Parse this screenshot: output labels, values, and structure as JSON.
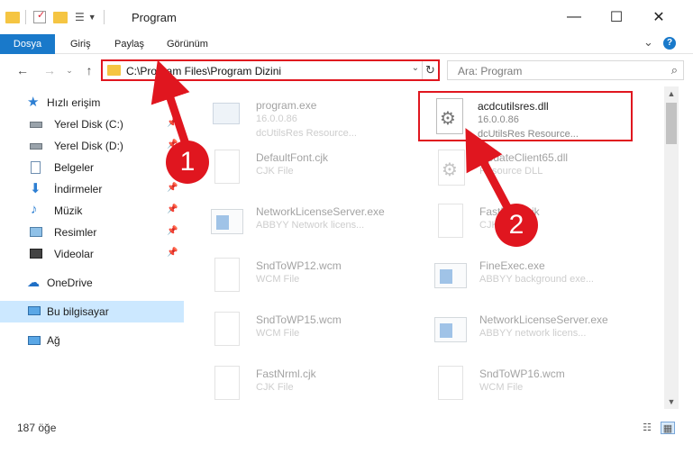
{
  "window": {
    "title": "Program",
    "minimize": "—",
    "maximize": "☐",
    "close": "✕"
  },
  "ribbon": {
    "tabs": [
      "Dosya",
      "Giriş",
      "Paylaş",
      "Görünüm"
    ],
    "collapse": "⌄",
    "help": "?"
  },
  "address": {
    "path": "C:\\Program Files\\Program Dizini",
    "search_placeholder": "Ara: Program"
  },
  "sidebar": {
    "items": [
      {
        "label": "Hızlı erişim",
        "icon": "star-icon"
      },
      {
        "label": "Yerel Disk (C:)",
        "icon": "drive-icon",
        "pinned": true
      },
      {
        "label": "Yerel Disk (D:)",
        "icon": "drive-icon",
        "pinned": true
      },
      {
        "label": "Belgeler",
        "icon": "documents-icon",
        "pinned": true
      },
      {
        "label": "İndirmeler",
        "icon": "download-icon",
        "pinned": true
      },
      {
        "label": "Müzik",
        "icon": "music-icon",
        "pinned": true
      },
      {
        "label": "Resimler",
        "icon": "pictures-icon",
        "pinned": true
      },
      {
        "label": "Videolar",
        "icon": "videos-icon",
        "pinned": true
      },
      {
        "label": "OneDrive",
        "icon": "cloud-icon"
      },
      {
        "label": "Bu bilgisayar",
        "icon": "computer-icon",
        "selected": true
      },
      {
        "label": "Ağ",
        "icon": "network-icon"
      }
    ]
  },
  "files": [
    {
      "name": "program.exe",
      "type": "16.0.0.86",
      "desc": "dcUtilsRes Resource...",
      "icon": "exe-icon"
    },
    {
      "name": "acdcutilsres.dll",
      "type": "16.0.0.86",
      "desc": "dcUtilsRes Resource...",
      "icon": "dll-gear-icon",
      "highlighted": true
    },
    {
      "name": "DefaultFont.cjk",
      "type": "CJK File",
      "icon": "file-icon"
    },
    {
      "name": "UpdateClient65.dll",
      "type": "Resource DLL",
      "icon": "dll-gear-icon"
    },
    {
      "name": "NetworkLicenseServer.exe",
      "type": "ABBYY Network licens...",
      "icon": "app-window-icon"
    },
    {
      "name": "FastNrml.cjk",
      "type": "CJK File",
      "icon": "file-icon"
    },
    {
      "name": "SndToWP12.wcm",
      "type": "WCM File",
      "icon": "file-icon"
    },
    {
      "name": "FineExec.exe",
      "type": "ABBYY background exe...",
      "icon": "app-window-icon"
    },
    {
      "name": "SndToWP15.wcm",
      "type": "WCM File",
      "icon": "file-icon"
    },
    {
      "name": "NetworkLicenseServer.exe",
      "type": "ABBYY network licens...",
      "icon": "app-window-icon"
    },
    {
      "name": "FastNrml.cjk",
      "type": "CJK File",
      "icon": "file-icon"
    },
    {
      "name": "SndToWP16.wcm",
      "type": "WCM File",
      "icon": "file-icon"
    }
  ],
  "status": {
    "count": "187 öğe"
  },
  "annotations": {
    "marker1": "1",
    "marker2": "2",
    "color": "#e0161f"
  },
  "colors": {
    "accent": "#1979ca",
    "selection": "#cce8ff",
    "highlight": "#e0161f"
  }
}
